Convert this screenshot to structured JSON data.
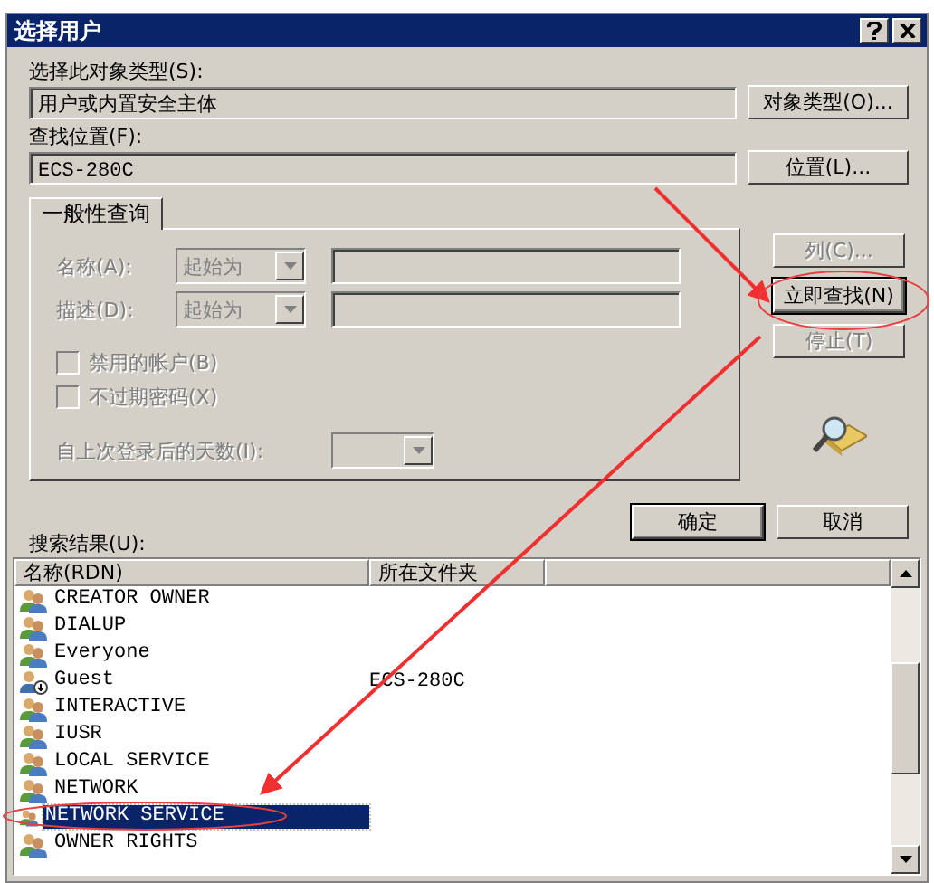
{
  "window": {
    "title": "选择用户"
  },
  "object_type": {
    "label": "选择此对象类型(S):",
    "value": "用户或内置安全主体",
    "button": "对象类型(O)..."
  },
  "location": {
    "label": "查找位置(F):",
    "value": "ECS-280C",
    "button": "位置(L)..."
  },
  "tabs": [
    {
      "label": "一般性查询",
      "selected": true
    }
  ],
  "query": {
    "fields": [
      {
        "label": "名称(A):",
        "match": "起始为",
        "disabled": true
      },
      {
        "label": "描述(D):",
        "match": "起始为",
        "disabled": true
      }
    ],
    "checkboxes": [
      {
        "label": "禁用的帐户(B)",
        "checked": false,
        "disabled": true
      },
      {
        "label": "不过期密码(X)",
        "checked": false,
        "disabled": true
      }
    ],
    "days": {
      "label": "自上次登录后的天数(I):",
      "disabled": true
    }
  },
  "side_buttons": [
    {
      "label": "列(C)...",
      "disabled": true,
      "default": false
    },
    {
      "label": "立即查找(N)",
      "disabled": false,
      "default": true
    },
    {
      "label": "停止(T)",
      "disabled": true,
      "default": false
    }
  ],
  "dialog_buttons": [
    {
      "label": "确定",
      "default": true
    },
    {
      "label": "取消",
      "default": false
    }
  ],
  "results": {
    "label": "搜索结果(U):",
    "columns": [
      "名称(RDN)",
      "所在文件夹"
    ],
    "rows": [
      {
        "name": "CREATOR OWNER",
        "folder": "",
        "kind": "group",
        "selected": false
      },
      {
        "name": "DIALUP",
        "kind": "group",
        "selected": false
      },
      {
        "name": "Everyone",
        "kind": "group",
        "selected": false
      },
      {
        "name": "Guest",
        "folder": "ECS-280C",
        "kind": "user",
        "selected": false
      },
      {
        "name": "INTERACTIVE",
        "kind": "group",
        "selected": false
      },
      {
        "name": "IUSR",
        "kind": "group",
        "selected": false
      },
      {
        "name": "LOCAL SERVICE",
        "kind": "group",
        "selected": false
      },
      {
        "name": "NETWORK",
        "kind": "group",
        "selected": false
      },
      {
        "name": "NETWORK SERVICE",
        "kind": "group",
        "selected": true
      },
      {
        "name": "OWNER RIGHTS",
        "kind": "group",
        "selected": false
      }
    ]
  }
}
